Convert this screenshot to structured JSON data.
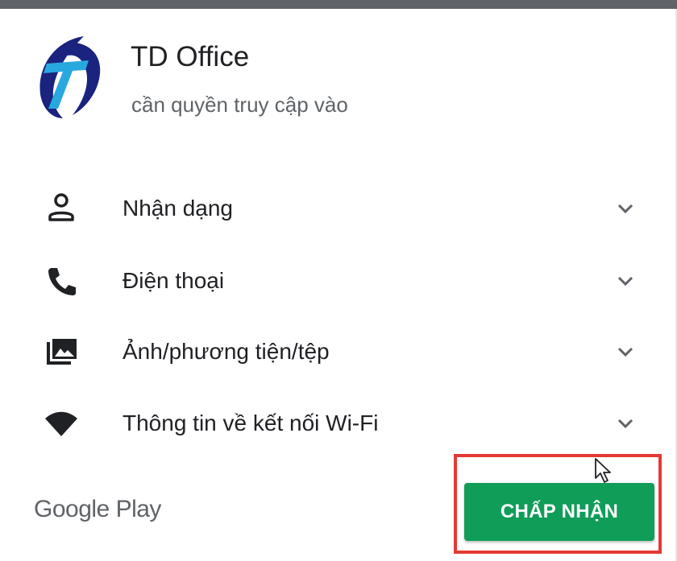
{
  "app": {
    "title": "TD Office",
    "subtitle": "cần quyền truy cập vào"
  },
  "permissions": [
    {
      "label": "Nhận dạng",
      "icon": "person-icon"
    },
    {
      "label": "Điện thoại",
      "icon": "phone-icon"
    },
    {
      "label": "Ảnh/phương tiện/tệp",
      "icon": "photo-folder-icon"
    },
    {
      "label": "Thông tin về kết nối Wi-Fi",
      "icon": "wifi-icon"
    }
  ],
  "footer": {
    "brand": "Google Play",
    "accept_label": "CHẤP NHẬN"
  },
  "colors": {
    "accept_button": "#0f9d58",
    "highlight": "#e53935",
    "logo_blue_dark": "#1a237e",
    "logo_blue_light": "#29a8e0"
  }
}
